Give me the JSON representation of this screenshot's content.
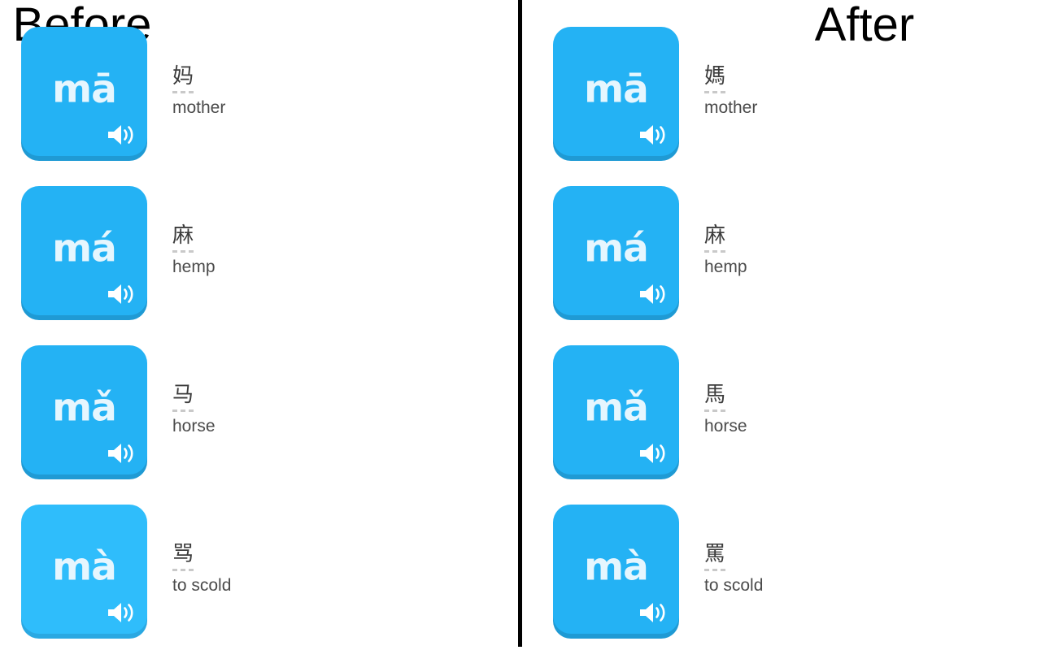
{
  "comparison": {
    "left_title": "Before",
    "right_title": "After",
    "accent_color": "#24b2f4",
    "accent_color_bright": "#2fbdfb",
    "card_edge_color": "#1f9ad4",
    "pinyin_color": "#e6f6fe",
    "divider_color": "#000000",
    "background_color": "#ffffff"
  },
  "left_panel": {
    "title": "Before",
    "cards": [
      {
        "pinyin": "mā",
        "hanzi": "妈",
        "meaning": "mother",
        "audio_icon": "speaker-icon",
        "highlighted": false
      },
      {
        "pinyin": "má",
        "hanzi": "麻",
        "meaning": "hemp",
        "audio_icon": "speaker-icon",
        "highlighted": false
      },
      {
        "pinyin": "mǎ",
        "hanzi": "马",
        "meaning": "horse",
        "audio_icon": "speaker-icon",
        "highlighted": false
      },
      {
        "pinyin": "mà",
        "hanzi": "骂",
        "meaning": "to scold",
        "audio_icon": "speaker-icon",
        "highlighted": true
      }
    ]
  },
  "right_panel": {
    "title": "After",
    "cards": [
      {
        "pinyin": "mā",
        "hanzi": "媽",
        "meaning": "mother",
        "audio_icon": "speaker-icon",
        "highlighted": false
      },
      {
        "pinyin": "má",
        "hanzi": "麻",
        "meaning": "hemp",
        "audio_icon": "speaker-icon",
        "highlighted": false
      },
      {
        "pinyin": "mǎ",
        "hanzi": "馬",
        "meaning": "horse",
        "audio_icon": "speaker-icon",
        "highlighted": false
      },
      {
        "pinyin": "mà",
        "hanzi": "罵",
        "meaning": "to scold",
        "audio_icon": "speaker-icon",
        "highlighted": false
      }
    ]
  }
}
